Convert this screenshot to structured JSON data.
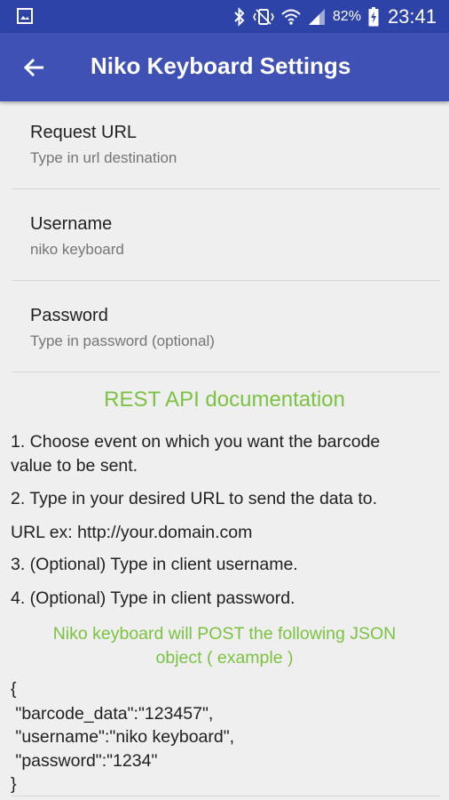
{
  "status_bar": {
    "icons": [
      "gallery-icon",
      "bluetooth-icon",
      "vibrate-icon",
      "wifi-icon",
      "signal-icon",
      "battery-icon"
    ],
    "battery_percent": "82%",
    "time": "23:41"
  },
  "app_bar": {
    "title": "Niko Keyboard Settings",
    "back_icon": "arrow-back-icon"
  },
  "preferences": [
    {
      "title": "Request URL",
      "summary": "Type in url destination"
    },
    {
      "title": "Username",
      "summary": "niko keyboard"
    },
    {
      "title": "Password",
      "summary": "Type in password (optional)"
    }
  ],
  "doc": {
    "title": "REST API documentation",
    "step1_line1": "1. Choose event on which you want the barcode",
    "step1_line2": "value to be sent.",
    "step2": "2. Type in your desired URL to send the data to.",
    "url_example": "URL ex: http://your.domain.com",
    "step3": "3. (Optional) Type in client username.",
    "step4": "4. (Optional) Type in client password.",
    "json_note_line1": "Niko keyboard will POST the following JSON",
    "json_note_line2": "object ( example )",
    "json_lines": [
      "{",
      " \"barcode_data\":\"123457\",",
      " \"username\":\"niko keyboard\",",
      " \"password\":\"1234\"",
      "}"
    ]
  },
  "colors": {
    "status_bar": "#2e43a8",
    "app_bar": "#3f51b5",
    "accent_green": "#7cc242",
    "background": "#efefef"
  }
}
